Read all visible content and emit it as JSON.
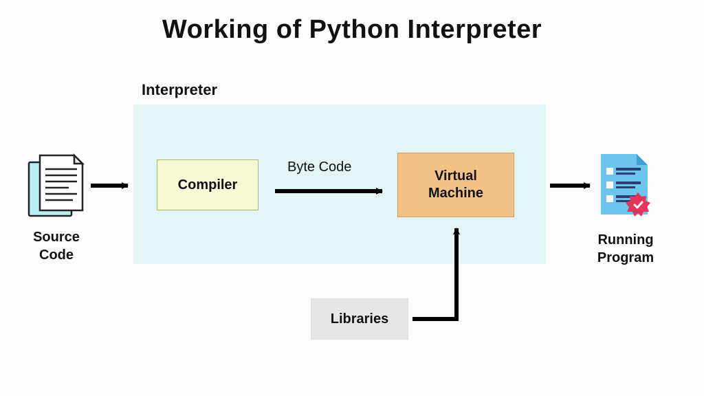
{
  "title": "Working of Python Interpreter",
  "interpreter": {
    "label": "Interpreter"
  },
  "nodes": {
    "source": {
      "label_line1": "Source",
      "label_line2": "Code"
    },
    "compiler": {
      "label": "Compiler"
    },
    "bytecode": {
      "label": "Byte Code"
    },
    "vm": {
      "label_line1": "Virtual",
      "label_line2": "Machine"
    },
    "running": {
      "label_line1": "Running",
      "label_line2": "Program"
    },
    "libraries": {
      "label": "Libraries"
    }
  },
  "colors": {
    "interpreter_bg": "#e3f5f5",
    "compiler_bg": "#f7fad4",
    "vm_bg": "#f3c286",
    "libraries_bg": "#e6e6e6",
    "running_icon": "#4bb0e8",
    "running_lines": "#2c3e70",
    "badge": "#e63358",
    "arrow": "#000000"
  },
  "flow": [
    "Source Code → Compiler",
    "Compiler → Byte Code → Virtual Machine",
    "Virtual Machine → Running Program",
    "Libraries → Virtual Machine"
  ]
}
